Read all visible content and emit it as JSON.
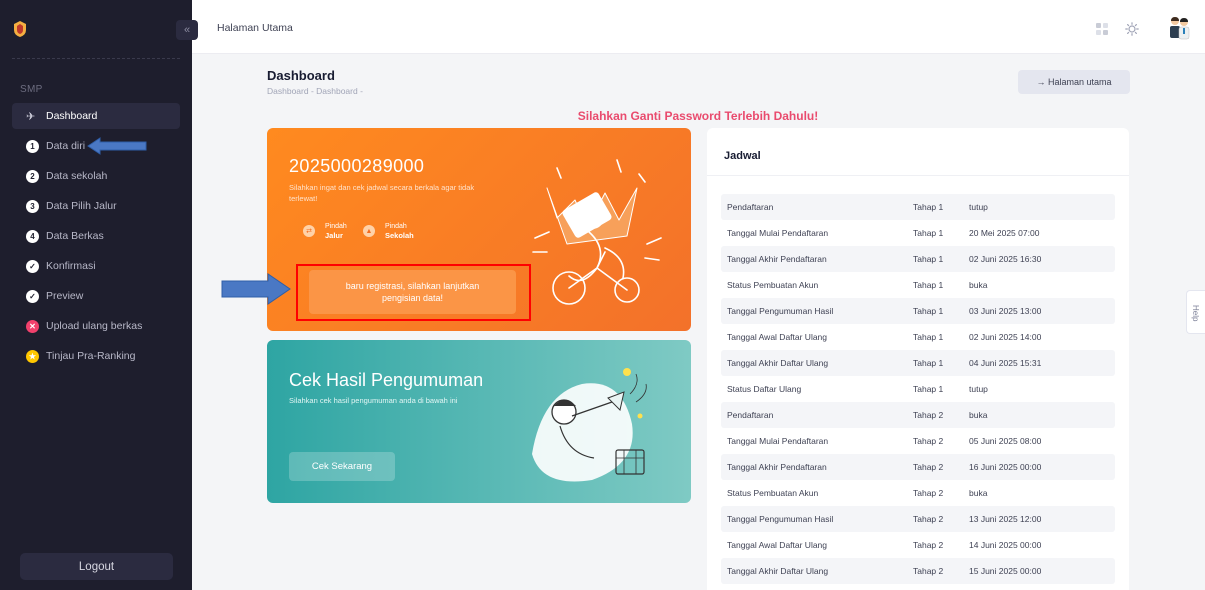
{
  "sidebar": {
    "section_label": "SMP",
    "items": [
      {
        "label": "Dashboard",
        "badge": ""
      },
      {
        "label": "Data diri",
        "badge": "1"
      },
      {
        "label": "Data sekolah",
        "badge": "2"
      },
      {
        "label": "Data Pilih Jalur",
        "badge": "3"
      },
      {
        "label": "Data Berkas",
        "badge": "4"
      },
      {
        "label": "Konfirmasi",
        "badge": "✓"
      },
      {
        "label": "Preview",
        "badge": "✓"
      },
      {
        "label": "Upload ulang berkas",
        "badge": "✕"
      },
      {
        "label": "Tinjau Pra-Ranking",
        "badge": "★"
      }
    ],
    "logout_label": "Logout",
    "collapse_glyph": "«"
  },
  "topbar": {
    "title": "Halaman Utama"
  },
  "header": {
    "title": "Dashboard",
    "breadcrumb": "Dashboard - Dashboard -",
    "home_button": "→ Halaman utama"
  },
  "warning": "Silahkan Ganti Password Terlebih Dahulu!",
  "registration_card": {
    "number": "2025000289000",
    "note": "Silahkan ingat dan cek jadwal secara berkala agar tidak terlewat!",
    "pindah_jalur": {
      "small": "Pindah",
      "bold": "Jalur"
    },
    "pindah_sekolah": {
      "small": "Pindah",
      "bold": "Sekolah"
    },
    "cta": "baru registrasi, silahkan lanjutkan pengisian data!"
  },
  "result_card": {
    "title": "Cek Hasil Pengumuman",
    "subtitle": "Silahkan cek hasil pengumuman anda di bawah ini",
    "button": "Cek Sekarang"
  },
  "schedule": {
    "title": "Jadwal",
    "rows": [
      [
        "Pendaftaran",
        "Tahap 1",
        "tutup"
      ],
      [
        "Tanggal Mulai Pendaftaran",
        "Tahap 1",
        "20 Mei 2025 07:00"
      ],
      [
        "Tanggal Akhir Pendaftaran",
        "Tahap 1",
        "02 Juni 2025 16:30"
      ],
      [
        "Status Pembuatan Akun",
        "Tahap 1",
        "buka"
      ],
      [
        "Tanggal Pengumuman Hasil",
        "Tahap 1",
        "03 Juni 2025 13:00"
      ],
      [
        "Tanggal Awal Daftar Ulang",
        "Tahap 1",
        "02 Juni 2025 14:00"
      ],
      [
        "Tanggal Akhir Daftar Ulang",
        "Tahap 1",
        "04 Juni 2025 15:31"
      ],
      [
        "Status Daftar Ulang",
        "Tahap 1",
        "tutup"
      ],
      [
        "Pendaftaran",
        "Tahap 2",
        "buka"
      ],
      [
        "Tanggal Mulai Pendaftaran",
        "Tahap 2",
        "05 Juni 2025 08:00"
      ],
      [
        "Tanggal Akhir Pendaftaran",
        "Tahap 2",
        "16 Juni 2025 00:00"
      ],
      [
        "Status Pembuatan Akun",
        "Tahap 2",
        "buka"
      ],
      [
        "Tanggal Pengumuman Hasil",
        "Tahap 2",
        "13 Juni 2025 12:00"
      ],
      [
        "Tanggal Awal Daftar Ulang",
        "Tahap 2",
        "14 Juni 2025 00:00"
      ],
      [
        "Tanggal Akhir Daftar Ulang",
        "Tahap 2",
        "15 Juni 2025 00:00"
      ]
    ]
  },
  "help_tab": "Help",
  "colors": {
    "sidebar_bg": "#1e1e2d",
    "orange": "#f3712a",
    "teal": "#2ea5a3",
    "warning": "#e94b6e",
    "annotation_blue": "#4a78c4",
    "annotation_red": "#ff0000"
  }
}
